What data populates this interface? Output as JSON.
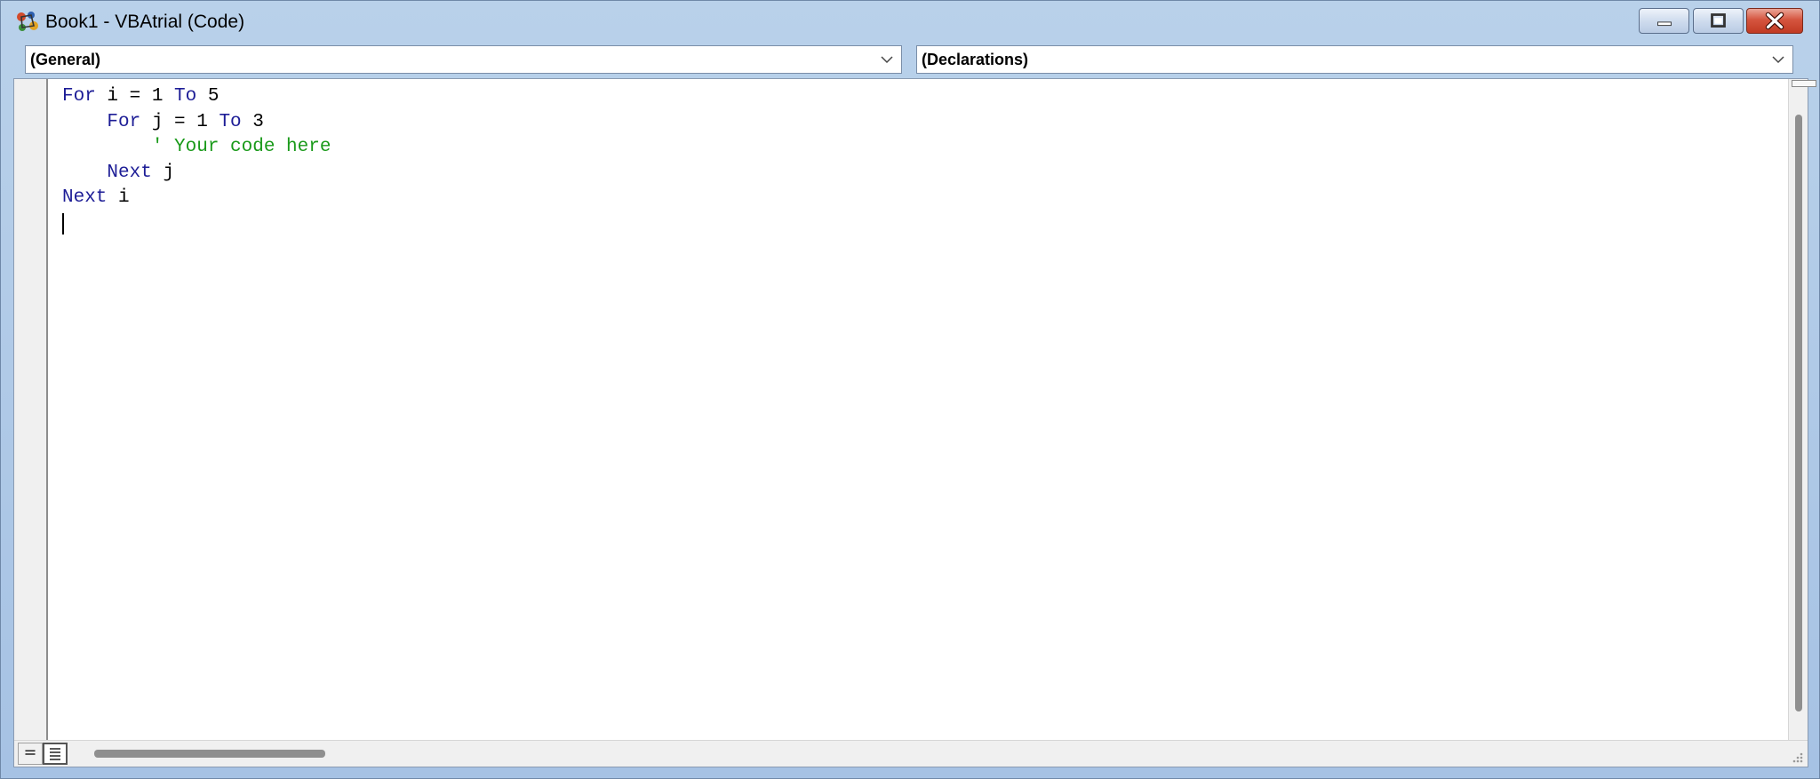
{
  "window": {
    "title": "Book1 - VBAtrial (Code)",
    "buttons": {
      "minimize": "minimize-icon",
      "maximize": "maximize-icon",
      "close": "close-icon"
    }
  },
  "combos": {
    "object": "(General)",
    "procedure": "(Declarations)"
  },
  "code": {
    "lines": [
      [
        {
          "t": "For",
          "c": "kw"
        },
        {
          "t": " i = 1 ",
          "c": "id"
        },
        {
          "t": "To",
          "c": "kw"
        },
        {
          "t": " 5",
          "c": "id"
        }
      ],
      [
        {
          "t": "    ",
          "c": "id"
        },
        {
          "t": "For",
          "c": "kw"
        },
        {
          "t": " j = 1 ",
          "c": "id"
        },
        {
          "t": "To",
          "c": "kw"
        },
        {
          "t": " 3",
          "c": "id"
        }
      ],
      [
        {
          "t": "        ' Your code here",
          "c": "cm"
        }
      ],
      [
        {
          "t": "    ",
          "c": "id"
        },
        {
          "t": "Next",
          "c": "kw"
        },
        {
          "t": " j",
          "c": "id"
        }
      ],
      [
        {
          "t": "Next",
          "c": "kw"
        },
        {
          "t": " i",
          "c": "id"
        }
      ],
      [
        {
          "t": "",
          "c": "id"
        }
      ]
    ]
  },
  "colors": {
    "keyword": "#1d1d96",
    "comment": "#1a9a1a",
    "text": "#000000",
    "frame": "#b9d1ea",
    "close_button": "#c13a23"
  }
}
